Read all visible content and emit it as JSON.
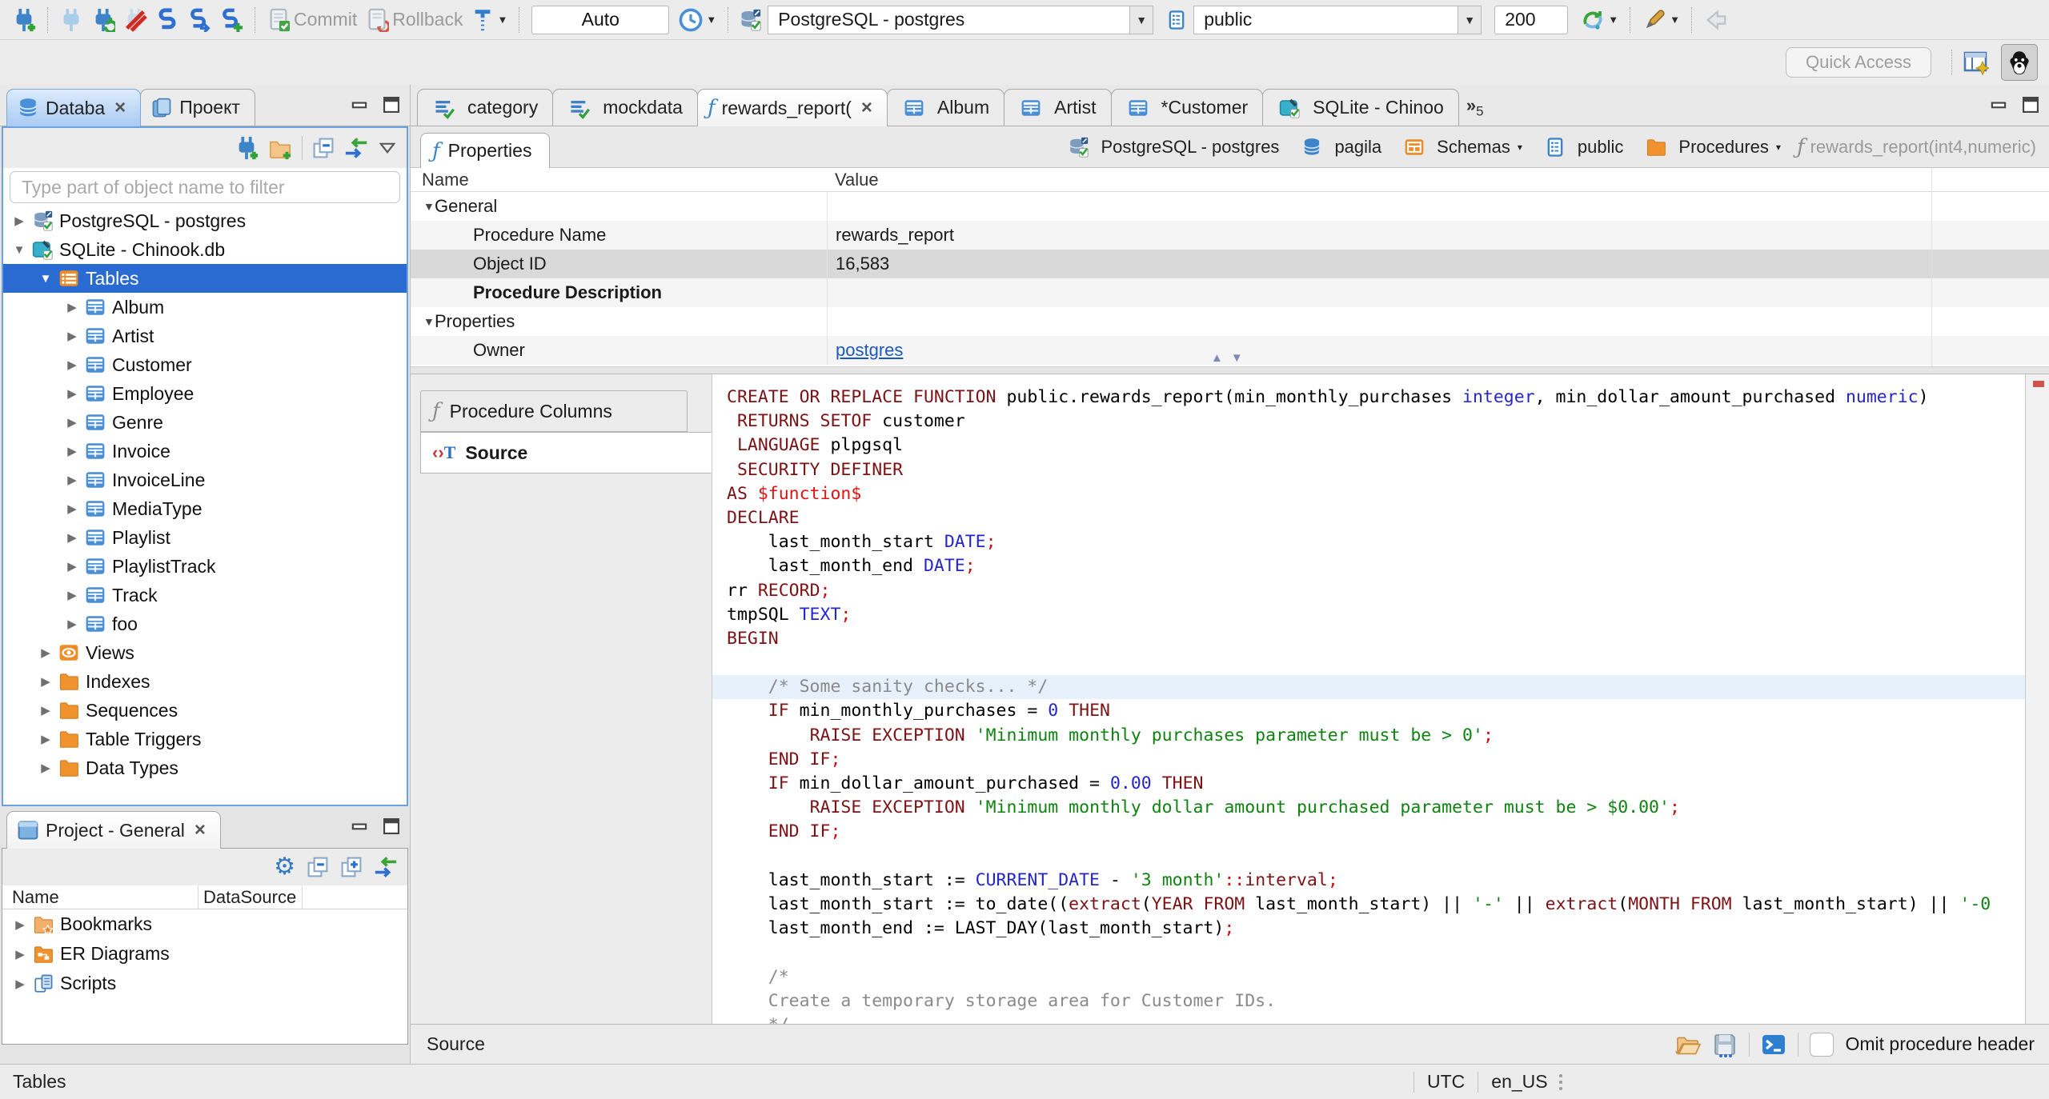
{
  "toolbar": {
    "commit_label": "Commit",
    "rollback_label": "Rollback",
    "auto_value": "Auto",
    "connection_value": "PostgreSQL - postgres",
    "schema_value": "public",
    "fetch_size_value": "200",
    "quick_access_placeholder": "Quick Access"
  },
  "colors": {
    "selection_blue": "#2a6bd2",
    "focused_panel_border": "#6ba3e0",
    "keyword": "#7d1214",
    "datatype": "#2525cc",
    "string": "#0f8310",
    "punctuation_red": "#cc0f0f",
    "comment": "#8a8a8a",
    "link": "#1a56c4",
    "current_line": "#e7f1fc"
  },
  "left_tabs": {
    "database_label": "Databa",
    "project_label": "Проект"
  },
  "db_navigator": {
    "filter_placeholder": "Type part of object name to filter",
    "tree": [
      {
        "label": "PostgreSQL - postgres",
        "level": 0,
        "arrow": "right",
        "icon": "postgres-connection"
      },
      {
        "label": "SQLite - Chinook.db",
        "level": 0,
        "arrow": "down",
        "icon": "sqlite-connection"
      },
      {
        "label": "Tables",
        "level": 1,
        "arrow": "down",
        "icon": "tables-folder",
        "selected": true
      },
      {
        "label": "Album",
        "level": 2,
        "arrow": "right",
        "icon": "table"
      },
      {
        "label": "Artist",
        "level": 2,
        "arrow": "right",
        "icon": "table"
      },
      {
        "label": "Customer",
        "level": 2,
        "arrow": "right",
        "icon": "table"
      },
      {
        "label": "Employee",
        "level": 2,
        "arrow": "right",
        "icon": "table"
      },
      {
        "label": "Genre",
        "level": 2,
        "arrow": "right",
        "icon": "table"
      },
      {
        "label": "Invoice",
        "level": 2,
        "arrow": "right",
        "icon": "table"
      },
      {
        "label": "InvoiceLine",
        "level": 2,
        "arrow": "right",
        "icon": "table"
      },
      {
        "label": "MediaType",
        "level": 2,
        "arrow": "right",
        "icon": "table"
      },
      {
        "label": "Playlist",
        "level": 2,
        "arrow": "right",
        "icon": "table"
      },
      {
        "label": "PlaylistTrack",
        "level": 2,
        "arrow": "right",
        "icon": "table"
      },
      {
        "label": "Track",
        "level": 2,
        "arrow": "right",
        "icon": "table"
      },
      {
        "label": "foo",
        "level": 2,
        "arrow": "right",
        "icon": "table"
      },
      {
        "label": "Views",
        "level": 1,
        "arrow": "right",
        "icon": "views"
      },
      {
        "label": "Indexes",
        "level": 1,
        "arrow": "right",
        "icon": "folder"
      },
      {
        "label": "Sequences",
        "level": 1,
        "arrow": "right",
        "icon": "folder"
      },
      {
        "label": "Table Triggers",
        "level": 1,
        "arrow": "right",
        "icon": "folder"
      },
      {
        "label": "Data Types",
        "level": 1,
        "arrow": "right",
        "icon": "folder"
      }
    ]
  },
  "project_panel": {
    "title": "Project - General",
    "columns": [
      "Name",
      "DataSource"
    ],
    "items": [
      {
        "label": "Bookmarks",
        "icon": "bookmarks-folder"
      },
      {
        "label": "ER Diagrams",
        "icon": "er-diagrams-folder"
      },
      {
        "label": "Scripts",
        "icon": "scripts"
      }
    ]
  },
  "editor_tabs": [
    {
      "label": "category",
      "icon": "sql-file"
    },
    {
      "label": "mockdata",
      "icon": "sql-file"
    },
    {
      "label": "rewards_report(",
      "icon": "function",
      "active": true,
      "closable": true
    },
    {
      "label": "Album",
      "icon": "table"
    },
    {
      "label": "Artist",
      "icon": "table"
    },
    {
      "label": "*Customer",
      "icon": "table"
    },
    {
      "label": "SQLite - Chinoo",
      "icon": "sqlite-connection"
    }
  ],
  "editor_tabs_overflow_count": "5",
  "properties_view": {
    "tab_label": "Properties",
    "breadcrumb": [
      {
        "label": "PostgreSQL - postgres",
        "icon": "postgres-connection"
      },
      {
        "label": "pagila",
        "icon": "database"
      },
      {
        "label": "Schemas",
        "icon": "schemas",
        "dropdown": true
      },
      {
        "label": "public",
        "icon": "schema-page"
      },
      {
        "label": "Procedures",
        "icon": "folder",
        "dropdown": true
      },
      {
        "label": "rewards_report(int4,numeric)",
        "icon": "function-gray",
        "muted": true
      }
    ],
    "grid_columns": [
      "Name",
      "Value"
    ],
    "grid_rows": [
      {
        "name": "General",
        "value": "",
        "group": true,
        "bg": "#ffffff"
      },
      {
        "name": "Procedure Name",
        "value": "rewards_report",
        "bg": "#f5f5f5"
      },
      {
        "name": "Object ID",
        "value": "16,583",
        "selected": true,
        "bg": "#d9d9d9"
      },
      {
        "name": "Procedure Description",
        "value": "",
        "bold": true,
        "bg": "#f5f5f5"
      },
      {
        "name": "Properties",
        "value": "",
        "group": true,
        "bg": "#ffffff"
      },
      {
        "name": "Owner",
        "value": "postgres",
        "link": true,
        "bg": "#f5f5f5"
      }
    ],
    "side_tabs": [
      {
        "label": "Procedure Columns",
        "icon": "function-gray"
      },
      {
        "label": "Source",
        "icon": "source-text",
        "active": true
      }
    ]
  },
  "source_code": {
    "lines": [
      {
        "t": [
          [
            "kw",
            "CREATE OR REPLACE FUNCTION"
          ],
          [
            "plain",
            " public.rewards_report(min_monthly_purchases "
          ],
          [
            "type",
            "integer"
          ],
          [
            "plain",
            ", min_dollar_amount_purchased "
          ],
          [
            "type",
            "numeric"
          ],
          [
            "plain",
            ")"
          ]
        ]
      },
      {
        "t": [
          [
            "plain",
            " "
          ],
          [
            "kw",
            "RETURNS SETOF"
          ],
          [
            "plain",
            " customer"
          ]
        ]
      },
      {
        "t": [
          [
            "plain",
            " "
          ],
          [
            "kw",
            "LANGUAGE"
          ],
          [
            "plain",
            " plpgsql"
          ]
        ]
      },
      {
        "t": [
          [
            "plain",
            " "
          ],
          [
            "kw",
            "SECURITY DEFINER"
          ]
        ]
      },
      {
        "t": [
          [
            "kw",
            "AS"
          ],
          [
            "plain",
            " "
          ],
          [
            "dollar",
            "$function$"
          ]
        ]
      },
      {
        "t": [
          [
            "kw",
            "DECLARE"
          ]
        ]
      },
      {
        "t": [
          [
            "plain",
            "    last_month_start "
          ],
          [
            "type",
            "DATE"
          ],
          [
            "punc",
            ";"
          ]
        ]
      },
      {
        "t": [
          [
            "plain",
            "    last_month_end "
          ],
          [
            "type",
            "DATE"
          ],
          [
            "punc",
            ";"
          ]
        ]
      },
      {
        "t": [
          [
            "plain",
            "rr "
          ],
          [
            "kw",
            "RECORD"
          ],
          [
            "punc",
            ";"
          ]
        ]
      },
      {
        "t": [
          [
            "plain",
            "tmpSQL "
          ],
          [
            "type",
            "TEXT"
          ],
          [
            "punc",
            ";"
          ]
        ]
      },
      {
        "t": [
          [
            "kw",
            "BEGIN"
          ]
        ]
      },
      {
        "t": []
      },
      {
        "hl": true,
        "t": [
          [
            "com",
            "    /* Some sanity checks... */"
          ]
        ]
      },
      {
        "t": [
          [
            "plain",
            "    "
          ],
          [
            "kw",
            "IF"
          ],
          [
            "plain",
            " min_monthly_purchases = "
          ],
          [
            "num",
            "0"
          ],
          [
            "plain",
            " "
          ],
          [
            "kw",
            "THEN"
          ]
        ]
      },
      {
        "t": [
          [
            "plain",
            "        "
          ],
          [
            "kw",
            "RAISE EXCEPTION"
          ],
          [
            "plain",
            " "
          ],
          [
            "str",
            "'Minimum monthly purchases parameter must be > 0'"
          ],
          [
            "punc",
            ";"
          ]
        ]
      },
      {
        "t": [
          [
            "plain",
            "    "
          ],
          [
            "kw",
            "END IF"
          ],
          [
            "punc",
            ";"
          ]
        ]
      },
      {
        "t": [
          [
            "plain",
            "    "
          ],
          [
            "kw",
            "IF"
          ],
          [
            "plain",
            " min_dollar_amount_purchased = "
          ],
          [
            "num",
            "0.00"
          ],
          [
            "plain",
            " "
          ],
          [
            "kw",
            "THEN"
          ]
        ]
      },
      {
        "t": [
          [
            "plain",
            "        "
          ],
          [
            "kw",
            "RAISE EXCEPTION"
          ],
          [
            "plain",
            " "
          ],
          [
            "str",
            "'Minimum monthly dollar amount purchased parameter must be > $0.00'"
          ],
          [
            "punc",
            ";"
          ]
        ]
      },
      {
        "t": [
          [
            "plain",
            "    "
          ],
          [
            "kw",
            "END IF"
          ],
          [
            "punc",
            ";"
          ]
        ]
      },
      {
        "t": []
      },
      {
        "t": [
          [
            "plain",
            "    last_month_start := "
          ],
          [
            "type",
            "CURRENT_DATE"
          ],
          [
            "plain",
            " - "
          ],
          [
            "str",
            "'3 month'"
          ],
          [
            "punc",
            "::"
          ],
          [
            "kw",
            "interval"
          ],
          [
            "punc",
            ";"
          ]
        ]
      },
      {
        "t": [
          [
            "plain",
            "    last_month_start := to_date(("
          ],
          [
            "kw",
            "extract"
          ],
          [
            "plain",
            "("
          ],
          [
            "kw",
            "YEAR FROM"
          ],
          [
            "plain",
            " last_month_start) || "
          ],
          [
            "str",
            "'-'"
          ],
          [
            "plain",
            " || "
          ],
          [
            "kw",
            "extract"
          ],
          [
            "plain",
            "("
          ],
          [
            "kw",
            "MONTH FROM"
          ],
          [
            "plain",
            " last_month_start) || "
          ],
          [
            "str",
            "'-0"
          ]
        ]
      },
      {
        "t": [
          [
            "plain",
            "    last_month_end := LAST_DAY(last_month_start)"
          ],
          [
            "punc",
            ";"
          ]
        ]
      },
      {
        "t": []
      },
      {
        "t": [
          [
            "com",
            "    /*"
          ]
        ]
      },
      {
        "t": [
          [
            "com",
            "    Create a temporary storage area for Customer IDs."
          ]
        ]
      },
      {
        "t": [
          [
            "com",
            "    */"
          ]
        ]
      }
    ]
  },
  "editor_footer": {
    "label": "Source",
    "omit_checkbox_label": "Omit procedure header"
  },
  "status_bar": {
    "left": "Tables",
    "timezone": "UTC",
    "locale": "en_US"
  }
}
